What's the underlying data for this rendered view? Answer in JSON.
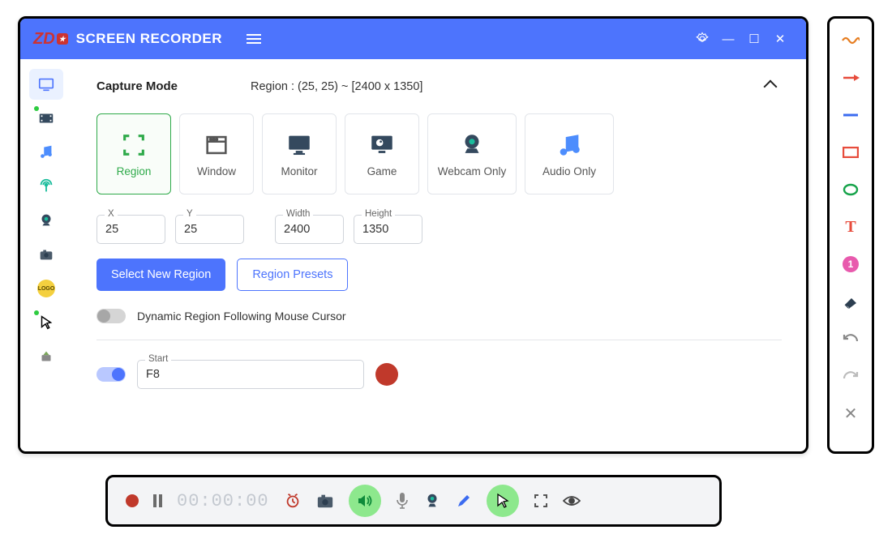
{
  "app": {
    "title": "SCREEN RECORDER",
    "brand": "ZD"
  },
  "section": {
    "title": "Capture Mode",
    "summary": "Region : (25, 25) ~ [2400 x 1350]"
  },
  "modes": {
    "region": "Region",
    "window": "Window",
    "monitor": "Monitor",
    "game": "Game",
    "webcam": "Webcam Only",
    "audio": "Audio Only"
  },
  "coords": {
    "x_label": "X",
    "x_value": "25",
    "y_label": "Y",
    "y_value": "25",
    "w_label": "Width",
    "w_value": "2400",
    "h_label": "Height",
    "h_value": "1350"
  },
  "buttons": {
    "select_region": "Select New Region",
    "region_presets": "Region Presets"
  },
  "dynamic_toggle_label": "Dynamic Region Following Mouse Cursor",
  "hotkey": {
    "start_label": "Start",
    "start_value": "F8"
  },
  "timer": "00:00:00"
}
